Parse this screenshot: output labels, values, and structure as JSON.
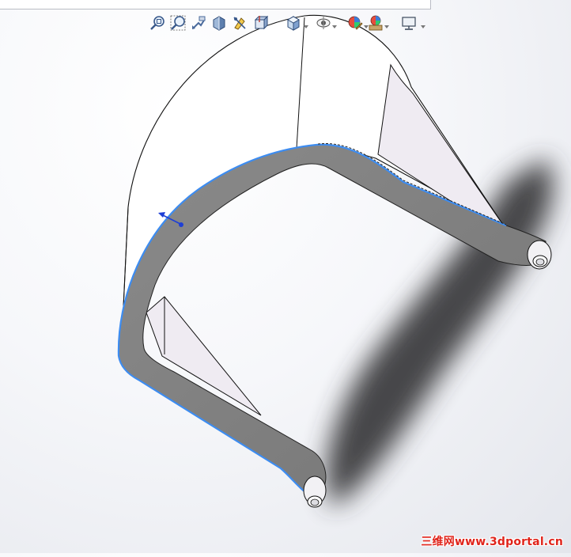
{
  "heads_up_toolbar": {
    "buttons": [
      {
        "id": "zoom-to-fit",
        "icon": "zoom-to-fit-icon"
      },
      {
        "id": "zoom-to-area",
        "icon": "zoom-to-area-icon"
      },
      {
        "id": "previous-view",
        "icon": "previous-view-icon"
      },
      {
        "id": "section-view",
        "icon": "section-view-icon"
      },
      {
        "id": "dynamic-annotation-views",
        "icon": "dynamic-annotation-icon"
      },
      {
        "id": "view-orientation",
        "icon": "view-orientation-icon"
      },
      {
        "id": "display-style",
        "icon": "display-style-icon"
      },
      {
        "id": "hide-show-items",
        "icon": "hide-show-icon"
      },
      {
        "id": "edit-appearance",
        "icon": "edit-appearance-icon"
      },
      {
        "id": "apply-scene",
        "icon": "apply-scene-icon"
      },
      {
        "id": "view-settings",
        "icon": "view-settings-icon"
      }
    ]
  },
  "colors": {
    "part_face": "#f5f3f7",
    "selected_face": "#7e7e7e",
    "selection_edge": "#3d8cf0",
    "shadow": "#3c3d40",
    "triad_arrow": "#1e3fd6"
  },
  "watermark": {
    "text": "三维网www.3dportal.cn"
  }
}
